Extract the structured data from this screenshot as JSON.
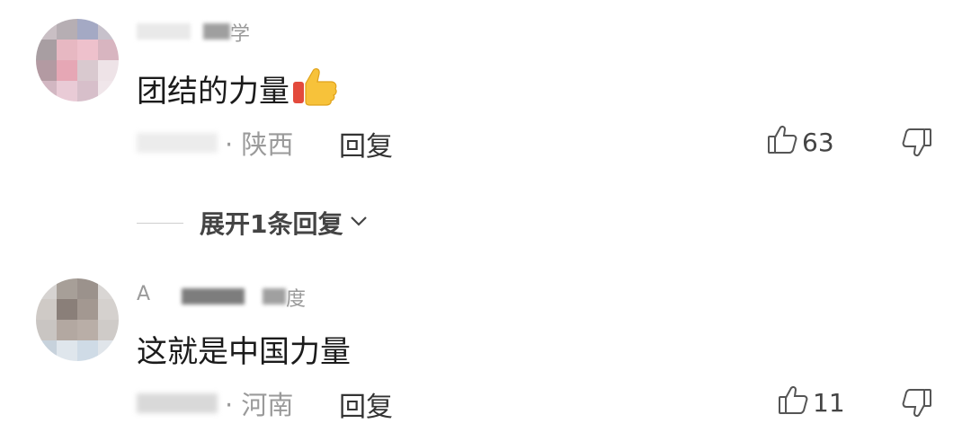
{
  "comments": [
    {
      "username_suffix": "学",
      "text": "团结的力量",
      "location": "· 陕西",
      "reply_label": "回复",
      "like_count": "63",
      "expand_label": "展开1条回复"
    },
    {
      "username_prefix": "A",
      "username_suffix": "度",
      "text": "这就是中国力量",
      "location": "· 河南",
      "reply_label": "回复",
      "like_count": "11"
    }
  ],
  "icons": {
    "like": "thumb-up-outline-icon",
    "dislike": "thumb-down-outline-icon",
    "emoji": "thumbs-up-emoji",
    "expand": "chevron-down-icon"
  },
  "colors": {
    "text_primary": "#1b1b1b",
    "text_secondary": "#9a9a9a",
    "emoji_yellow": "#f7c23a",
    "emoji_red": "#e34a3c"
  }
}
